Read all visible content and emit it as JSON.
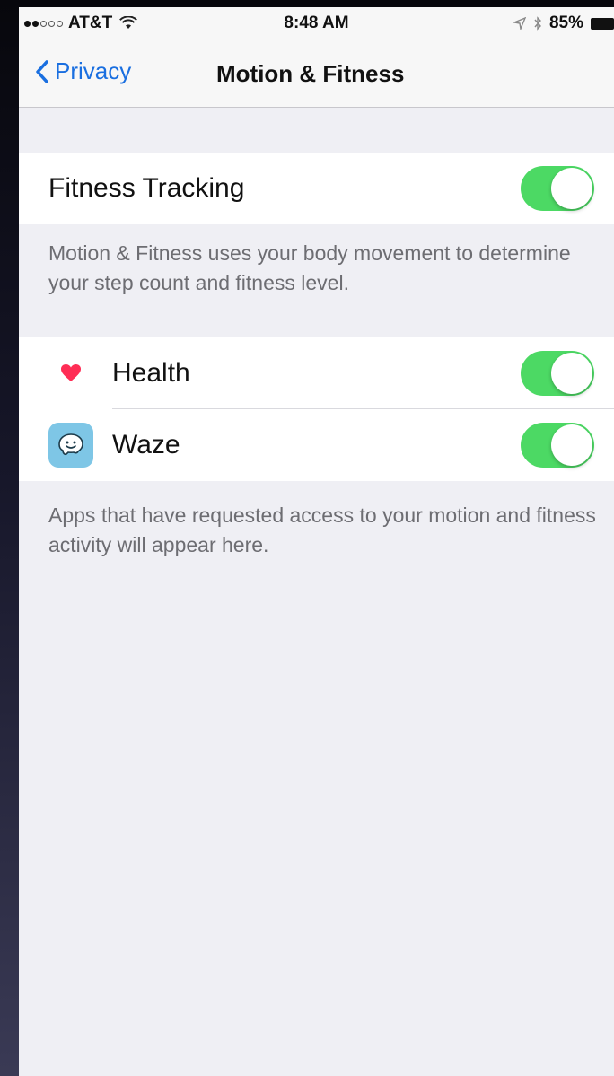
{
  "status_bar": {
    "carrier": "AT&T",
    "time": "8:48 AM",
    "battery": "85%"
  },
  "nav": {
    "back_label": "Privacy",
    "title": "Motion & Fitness"
  },
  "fitness_tracking": {
    "label": "Fitness Tracking",
    "enabled": true,
    "footer": "Motion & Fitness uses your body movement to determine your step count and fitness level."
  },
  "apps": {
    "items": [
      {
        "label": "Health",
        "icon": "heart-icon",
        "enabled": true
      },
      {
        "label": "Waze",
        "icon": "waze-icon",
        "enabled": true
      }
    ],
    "footer": "Apps that have requested access to your motion and fitness activity will appear here."
  },
  "colors": {
    "accent": "#1a6fe0",
    "toggle_on": "#4cd964",
    "background": "#efeff4",
    "waze": "#7ec6e6",
    "heart": "#ff2d55"
  }
}
